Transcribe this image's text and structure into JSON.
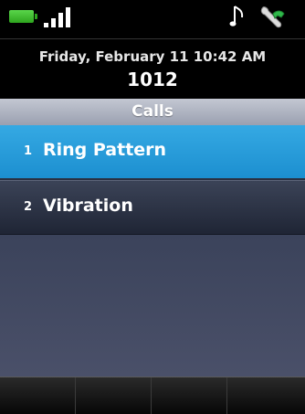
{
  "status_bar": {
    "battery_color": "#3cc22c",
    "icons": [
      "battery-icon",
      "signal-strength-icon",
      "music-note-icon",
      "wrench-phone-icon"
    ]
  },
  "header": {
    "datetime": "Friday, February 11 10:42 AM",
    "extension": "1012"
  },
  "title_bar": {
    "title": "Calls"
  },
  "menu": {
    "items": [
      {
        "number": "1",
        "label": "Ring Pattern",
        "selected": true
      },
      {
        "number": "2",
        "label": "Vibration",
        "selected": false
      }
    ]
  },
  "colors": {
    "selected_item": "#2a9ddb",
    "title_bar": "#aeb3c1",
    "menu_background": "#3a425a"
  },
  "softkeys": {
    "labels": [
      "",
      "",
      "",
      ""
    ]
  }
}
